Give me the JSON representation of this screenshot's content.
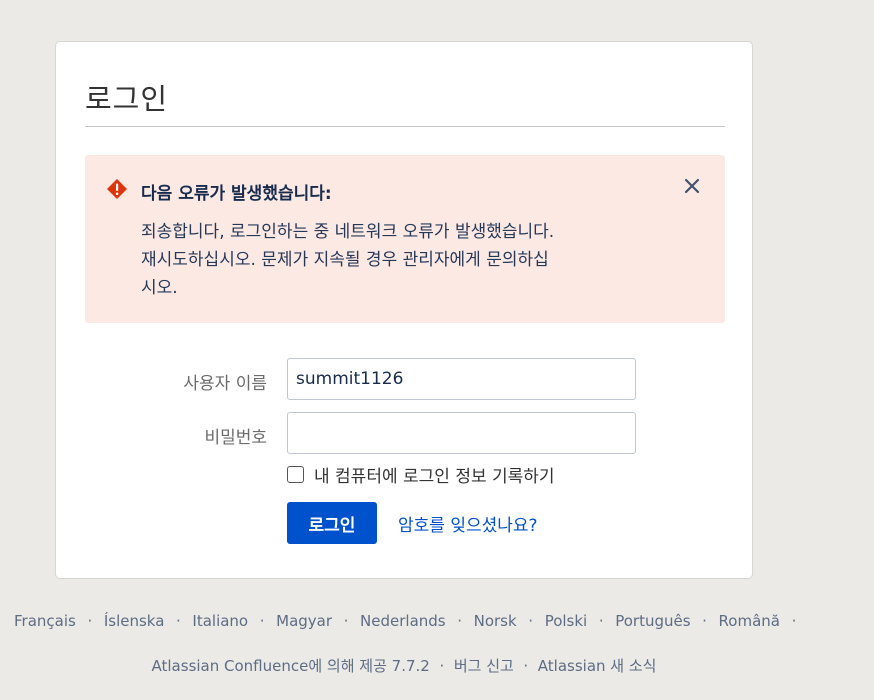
{
  "login": {
    "title": "로그인",
    "error": {
      "title": "다음 오류가 발생했습니다:",
      "message_line1": "죄송합니다, 로그인하는 중 네트워크 오류가 발생했습니다.",
      "message_line2": "재시도하십시오. 문제가 지속될 경우 관리자에게 문의하십",
      "message_line3": "시오.",
      "icon": "error-icon",
      "close_icon": "close-icon",
      "color": "#de350b"
    },
    "username_label": "사용자 이름",
    "username_value": "summit1126",
    "password_label": "비밀번호",
    "password_value": "",
    "remember_label": "내 컴퓨터에 로그인 정보 기록하기",
    "login_button": "로그인",
    "forgot_link": "암호를 잊으셨나요?"
  },
  "languages": [
    "Français",
    "Íslenska",
    "Italiano",
    "Magyar",
    "Nederlands",
    "Norsk",
    "Polski",
    "Português",
    "Română"
  ],
  "footer": {
    "powered_by": "Atlassian Confluence에 의해 제공 7.7.2",
    "bug_report": "버그 신고",
    "news": "Atlassian 새 소식"
  },
  "colors": {
    "accent": "#0052cc",
    "error_bg": "#fde9e4"
  }
}
